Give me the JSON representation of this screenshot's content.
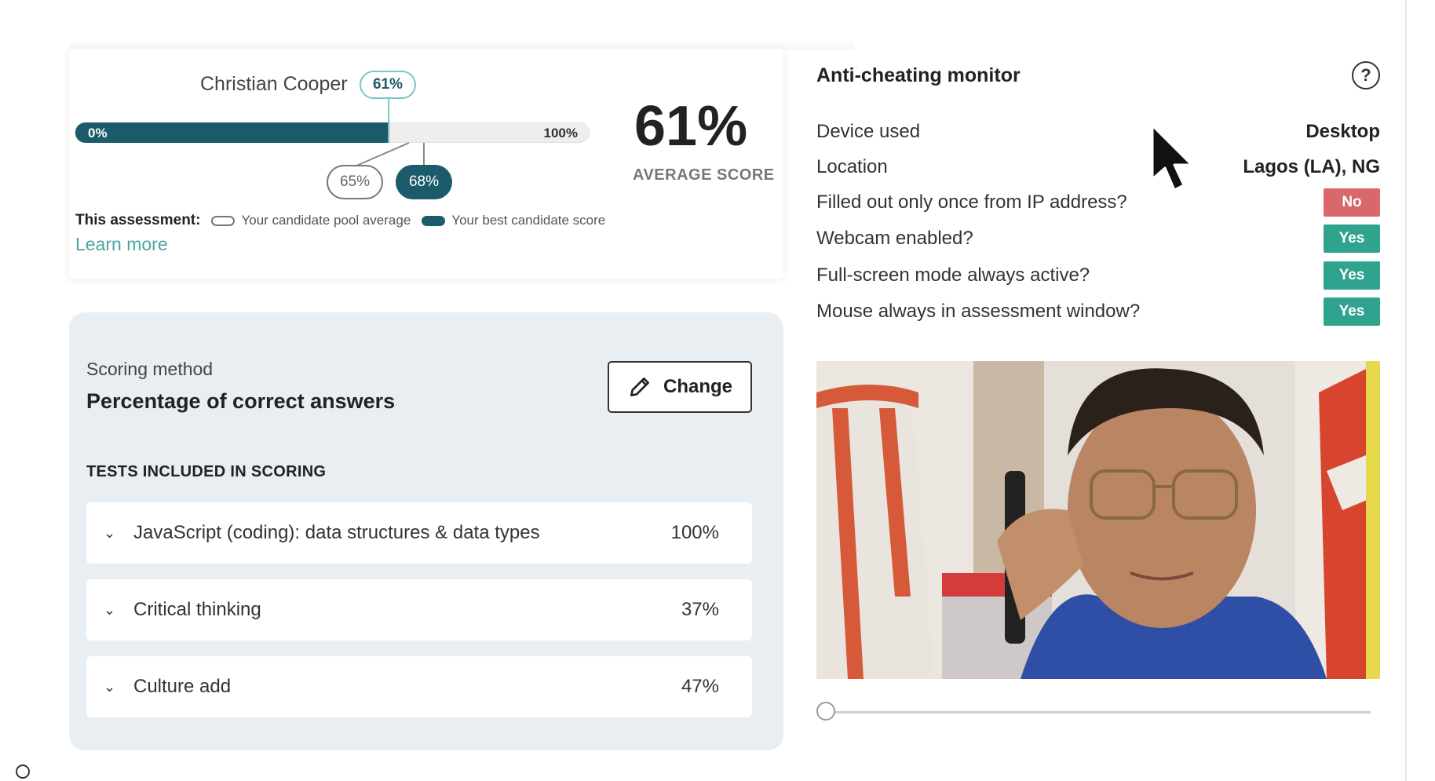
{
  "score_card": {
    "candidate_name": "Christian Cooper",
    "candidate_score_label": "61%",
    "candidate_score": 61,
    "bar_start_label": "0%",
    "bar_end_label": "100%",
    "pool_average_label": "65%",
    "pool_average": 65,
    "best_score_label": "68%",
    "best_score": 68,
    "big_score": "61%",
    "average_score_label": "AVERAGE SCORE",
    "legend_title": "This assessment:",
    "legend_pool": "Your candidate pool average",
    "legend_best": "Your best candidate score",
    "learn_more": "Learn more",
    "colors": {
      "bar_fill": "#1b5b6b",
      "pill_outline": "#7fc4c4"
    }
  },
  "scoring": {
    "method_label": "Scoring method",
    "method_value": "Percentage of correct answers",
    "change_label": "Change",
    "change_icon": "pencil-icon",
    "tests_heading": "TESTS INCLUDED IN SCORING",
    "tests": [
      {
        "name": "JavaScript (coding): data structures & data types",
        "score": "100%"
      },
      {
        "name": "Critical thinking",
        "score": "37%"
      },
      {
        "name": "Culture add",
        "score": "47%"
      }
    ]
  },
  "anti_cheat": {
    "title": "Anti-cheating monitor",
    "help_icon": "help-circle-icon",
    "rows": [
      {
        "label": "Device used",
        "value": "Desktop"
      },
      {
        "label": "Location",
        "value": "Lagos (LA), NG"
      },
      {
        "label": "Filled out only once from IP address?",
        "value": "No"
      },
      {
        "label": "Webcam enabled?",
        "value": "Yes"
      },
      {
        "label": "Full-screen mode always active?",
        "value": "Yes"
      },
      {
        "label": "Mouse always in assessment window?",
        "value": "Yes"
      }
    ],
    "colors": {
      "no": "#d9686b",
      "yes": "#2fa38d"
    },
    "slider_position": 0
  }
}
